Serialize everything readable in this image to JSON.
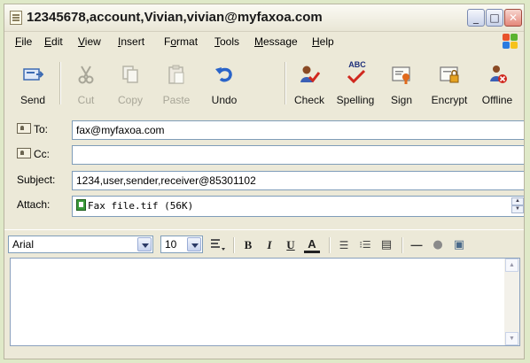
{
  "window": {
    "title": "12345678,account,Vivian,vivian@myfaxoa.com",
    "controls": {
      "minimize": "_",
      "maximize": "□",
      "close": "✕"
    }
  },
  "menu": [
    {
      "first": "F",
      "rest": "ile"
    },
    {
      "first": "E",
      "rest": "dit"
    },
    {
      "first": "V",
      "rest": "iew"
    },
    {
      "first": "I",
      "rest": "nsert"
    },
    {
      "pre": "F",
      "first": "o",
      "rest": "rmat"
    },
    {
      "first": "T",
      "rest": "ools"
    },
    {
      "first": "M",
      "rest": "essage"
    },
    {
      "first": "H",
      "rest": "elp"
    }
  ],
  "toolbar": {
    "send": "Send",
    "cut": "Cut",
    "copy": "Copy",
    "paste": "Paste",
    "undo": "Undo",
    "check": "Check",
    "spelling": "Spelling",
    "spelling_glyph": "ABC",
    "sign": "Sign",
    "encrypt": "Encrypt",
    "offline": "Offline",
    "disabled": [
      "cut",
      "copy",
      "paste"
    ]
  },
  "header": {
    "to_label": "To:",
    "to_value": "fax@myfaxoa.com",
    "cc_label": "Cc:",
    "cc_value": "",
    "subject_label": "Subject:",
    "subject_value": "1234,user,sender,receiver@85301102",
    "attach_label": "Attach:",
    "attach_file": "Fax file.tif (56K)"
  },
  "format": {
    "font": "Arial",
    "size": "10",
    "bold": "B",
    "italic": "I",
    "underline": "U",
    "font_color": "A",
    "numbered_list": "☰",
    "bullets": "⁝☰",
    "align": "▤",
    "line": "—",
    "link": "●",
    "image": "▣"
  },
  "colors": {
    "background": "#dfe9c8",
    "window": "#ece9d8",
    "field_border": "#7f9db9",
    "undo_blue": "#2a64c9",
    "spell_check_red": "#d0281e"
  }
}
